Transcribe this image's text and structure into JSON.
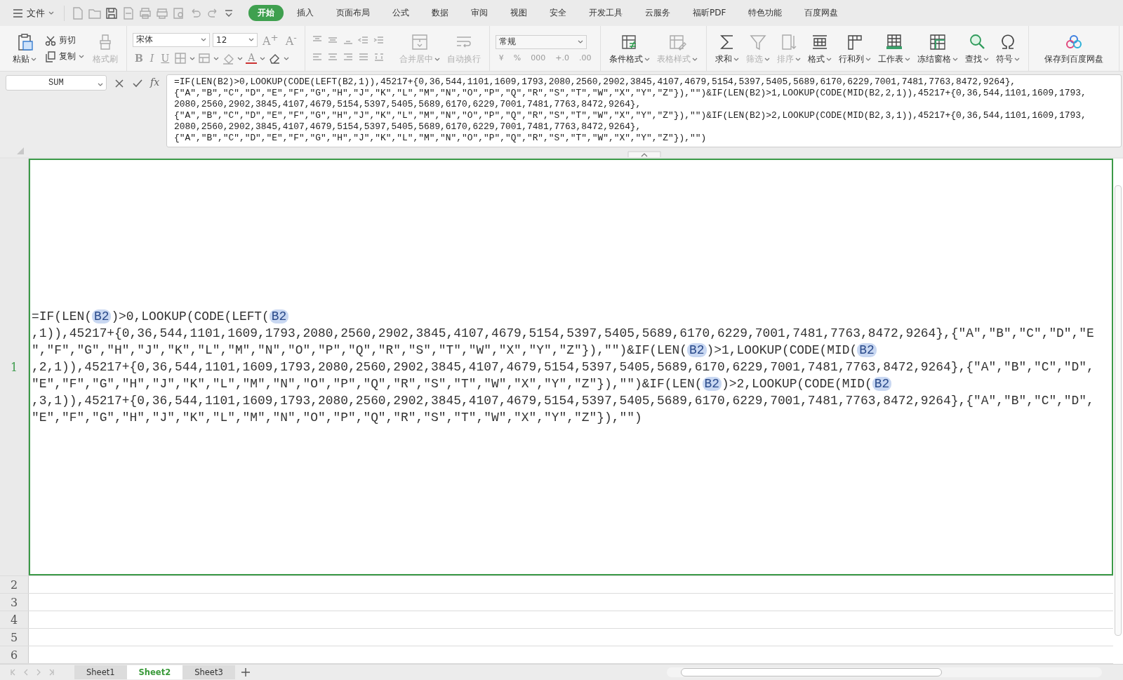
{
  "menubar": {
    "file_menu": "文件",
    "tabs": [
      {
        "label": "开始",
        "selected": true
      },
      {
        "label": "插入",
        "selected": false
      },
      {
        "label": "页面布局",
        "selected": false
      },
      {
        "label": "公式",
        "selected": false
      },
      {
        "label": "数据",
        "selected": false
      },
      {
        "label": "审阅",
        "selected": false
      },
      {
        "label": "视图",
        "selected": false
      },
      {
        "label": "安全",
        "selected": false
      },
      {
        "label": "开发工具",
        "selected": false
      },
      {
        "label": "云服务",
        "selected": false
      },
      {
        "label": "福昕PDF",
        "selected": false
      },
      {
        "label": "特色功能",
        "selected": false
      },
      {
        "label": "百度网盘",
        "selected": false
      }
    ]
  },
  "ribbon": {
    "clipboard": [
      {
        "label": "粘贴",
        "kind": "large",
        "dropdown": true,
        "disabled": false
      },
      {
        "label": "剪切",
        "kind": "small",
        "dropdown": false,
        "disabled": false
      },
      {
        "label": "复制",
        "kind": "small",
        "dropdown": true,
        "disabled": false
      },
      {
        "label": "格式刷",
        "kind": "large",
        "dropdown": false,
        "disabled": true
      }
    ],
    "font_name": "宋体",
    "font_size": "12",
    "font_size_buttons": [
      "A$^{+}$",
      "A$^{-}$"
    ],
    "font_style_buttons": [
      "B",
      "I",
      "U"
    ],
    "font_color_button": "A",
    "align_buttons": [
      {
        "label": "合并居中",
        "dropdown": true,
        "disabled": true
      },
      {
        "label": "自动换行",
        "dropdown": false,
        "disabled": true
      }
    ],
    "number_format": "常规",
    "number_buttons": [
      "¥",
      "%",
      "000",
      "+.0",
      ".00"
    ],
    "style_buttons": [
      {
        "label": "条件格式",
        "dropdown": true,
        "disabled": false
      },
      {
        "label": "表格样式",
        "dropdown": true,
        "disabled": true
      }
    ],
    "edit_buttons": [
      {
        "label": "求和",
        "dropdown": true,
        "disabled": false
      },
      {
        "label": "筛选",
        "dropdown": true,
        "disabled": true
      },
      {
        "label": "排序",
        "dropdown": true,
        "disabled": true
      },
      {
        "label": "格式",
        "dropdown": true,
        "disabled": false
      },
      {
        "label": "行和列",
        "dropdown": true,
        "disabled": false
      },
      {
        "label": "工作表",
        "dropdown": true,
        "disabled": false
      },
      {
        "label": "冻结窗格",
        "dropdown": true,
        "disabled": false
      },
      {
        "label": "查找",
        "dropdown": true,
        "disabled": false
      },
      {
        "label": "符号",
        "dropdown": true,
        "disabled": false
      }
    ],
    "cloud_button": "保存到百度网盘"
  },
  "formula_bar": {
    "name_box": "SUM",
    "fx": "fx",
    "lines": [
      "=IF(LEN(B2)>0,LOOKUP(CODE(LEFT(B2,1)),45217+{0,36,544,1101,1609,1793,2080,2560,2902,3845,4107,4679,5154,5397,5405,5689,6170,6229,7001,7481,7763,8472,9264},",
      "{\"A\",\"B\",\"C\",\"D\",\"E\",\"F\",\"G\",\"H\",\"J\",\"K\",\"L\",\"M\",\"N\",\"O\",\"P\",\"Q\",\"R\",\"S\",\"T\",\"W\",\"X\",\"Y\",\"Z\"}),\"\")&IF(LEN(B2)>1,LOOKUP(CODE(MID(B2,2,1)),45217+{0,36,544,1101,1609,1793,",
      "2080,2560,2902,3845,4107,4679,5154,5397,5405,5689,6170,6229,7001,7481,7763,8472,9264},",
      "{\"A\",\"B\",\"C\",\"D\",\"E\",\"F\",\"G\",\"H\",\"J\",\"K\",\"L\",\"M\",\"N\",\"O\",\"P\",\"Q\",\"R\",\"S\",\"T\",\"W\",\"X\",\"Y\",\"Z\"}),\"\")&IF(LEN(B2)>2,LOOKUP(CODE(MID(B2,3,1)),45217+{0,36,544,1101,1609,1793,",
      "2080,2560,2902,3845,4107,4679,5154,5397,5405,5689,6170,6229,7001,7481,7763,8472,9264},",
      "{\"A\",\"B\",\"C\",\"D\",\"E\",\"F\",\"G\",\"H\",\"J\",\"K\",\"L\",\"M\",\"N\",\"O\",\"P\",\"Q\",\"R\",\"S\",\"T\",\"W\",\"X\",\"Y\",\"Z\"}),\"\")"
    ]
  },
  "sheet": {
    "rows": [
      {
        "header": "1",
        "selected": true,
        "lines": [
          [
            {
              "kind": "text",
              "text": "=IF(LEN("
            },
            {
              "kind": "ref",
              "text": "B2"
            },
            {
              "kind": "text",
              "text": ")>0,LOOKUP(CODE(LEFT("
            },
            {
              "kind": "ref",
              "text": "B2"
            }
          ],
          [
            {
              "kind": "text",
              "text": ",1)),45217+{0,36,544,1101,1609,1793,2080,2560,2902,3845,4107,4679,5154,5397,5405,5689,6170,6229,7001,7481,7763,8472,9264},{\"A\",\"B\",\"C\",\"D\",\"E"
            }
          ],
          [
            {
              "kind": "text",
              "text": "\",\"F\",\"G\",\"H\",\"J\",\"K\",\"L\",\"M\",\"N\",\"O\",\"P\",\"Q\",\"R\",\"S\",\"T\",\"W\",\"X\",\"Y\",\"Z\"}),\"\")&IF(LEN("
            },
            {
              "kind": "ref",
              "text": "B2"
            },
            {
              "kind": "text",
              "text": ")>1,LOOKUP(CODE(MID("
            },
            {
              "kind": "ref",
              "text": "B2"
            }
          ],
          [
            {
              "kind": "text",
              "text": ",2,1)),45217+{0,36,544,1101,1609,1793,2080,2560,2902,3845,4107,4679,5154,5397,5405,5689,6170,6229,7001,7481,7763,8472,9264},{\"A\",\"B\",\"C\",\"D\","
            }
          ],
          [
            {
              "kind": "text",
              "text": "\"E\",\"F\",\"G\",\"H\",\"J\",\"K\",\"L\",\"M\",\"N\",\"O\",\"P\",\"Q\",\"R\",\"S\",\"T\",\"W\",\"X\",\"Y\",\"Z\"}),\"\")&IF(LEN("
            },
            {
              "kind": "ref",
              "text": "B2"
            },
            {
              "kind": "text",
              "text": ")>2,LOOKUP(CODE(MID("
            },
            {
              "kind": "ref",
              "text": "B2"
            }
          ],
          [
            {
              "kind": "text",
              "text": ",3,1)),45217+{0,36,544,1101,1609,1793,2080,2560,2902,3845,4107,4679,5154,5397,5405,5689,6170,6229,7001,7481,7763,8472,9264},{\"A\",\"B\",\"C\",\"D\","
            }
          ],
          [
            {
              "kind": "text",
              "text": "\"E\",\"F\",\"G\",\"H\",\"J\",\"K\",\"L\",\"M\",\"N\",\"O\",\"P\",\"Q\",\"R\",\"S\",\"T\",\"W\",\"X\",\"Y\",\"Z\"}),\"\")"
            }
          ]
        ]
      },
      {
        "header": "2",
        "selected": false
      },
      {
        "header": "3",
        "selected": false
      },
      {
        "header": "4",
        "selected": false
      },
      {
        "header": "5",
        "selected": false
      },
      {
        "header": "6",
        "selected": false
      }
    ]
  },
  "sheet_tabs": [
    {
      "label": "Sheet1",
      "selected": false
    },
    {
      "label": "Sheet2",
      "selected": true
    },
    {
      "label": "Sheet3",
      "selected": false
    }
  ]
}
